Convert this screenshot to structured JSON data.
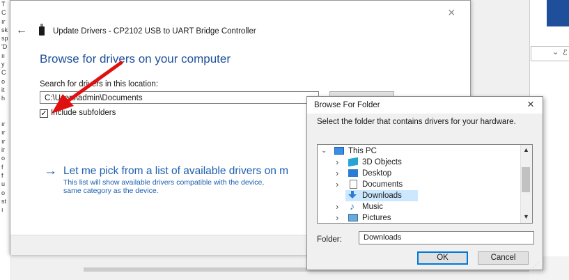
{
  "background": {
    "left_fragments": [
      "T",
      "C",
      "ır",
      "sk",
      "sp",
      "'D",
      "ıı",
      "y",
      "C",
      "o",
      "it",
      "h",
      "",
      "",
      "ır",
      "ır",
      "ır",
      "ir",
      "o",
      "f",
      "f",
      "u",
      "o",
      "st",
      "ı"
    ],
    "right_dropdown_chevron": "⌄",
    "right_dropdown_text": "ℰ"
  },
  "wizard": {
    "back_icon": "←",
    "close_icon": "×",
    "title": "Update Drivers - CP2102 USB to UART Bridge Controller",
    "heading": "Browse for drivers on your computer",
    "search_label": "Search for drivers in this location:",
    "path_value": "C:\\Users\\admin\\Documents",
    "include_subfolders_label": "Include subfolders",
    "include_subfolders_checked": "✓",
    "link_arrow": "→",
    "link_text": "Let me pick from a list of available drivers on m",
    "link_desc_line1": "This list will show available drivers compatible with the device,",
    "link_desc_line2": "same category as the device."
  },
  "browse_folder": {
    "title": "Browse For Folder",
    "close_icon": "×",
    "instruction": "Select the folder that contains drivers for your hardware.",
    "tree": [
      {
        "label": "This PC",
        "toggle": "⌄",
        "icon": "pc-icon",
        "level": 0
      },
      {
        "label": "3D Objects",
        "toggle": "›",
        "icon": "3d-objects-icon",
        "level": 1
      },
      {
        "label": "Desktop",
        "toggle": "›",
        "icon": "desktop-icon",
        "level": 1
      },
      {
        "label": "Documents",
        "toggle": "›",
        "icon": "documents-icon",
        "level": 1
      },
      {
        "label": "Downloads",
        "toggle": "",
        "icon": "downloads-icon",
        "level": 1,
        "selected": true
      },
      {
        "label": "Music",
        "toggle": "›",
        "icon": "music-icon",
        "level": 1
      },
      {
        "label": "Pictures",
        "toggle": "›",
        "icon": "pictures-icon",
        "level": 1
      }
    ],
    "scroll_up": "▲",
    "scroll_down": "▼",
    "folder_label": "Folder:",
    "folder_value": "Downloads",
    "ok_label": "OK",
    "cancel_label": "Cancel"
  },
  "colors": {
    "link_blue": "#1b5fb0",
    "heading_blue": "#1b4f9a",
    "selection": "#cce8ff",
    "annotation_red": "#e01010"
  }
}
